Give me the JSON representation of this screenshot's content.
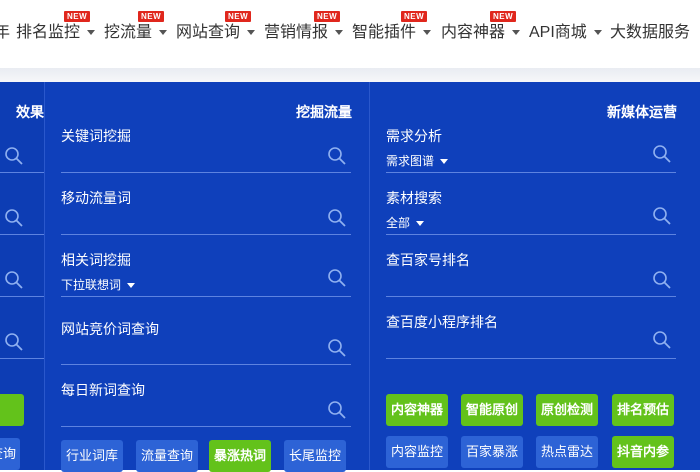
{
  "nav": {
    "items": [
      {
        "label": "年",
        "caret": false,
        "badge": ""
      },
      {
        "label": "排名监控",
        "caret": true,
        "badge": "NEW"
      },
      {
        "label": "挖流量",
        "caret": true,
        "badge": "NEW"
      },
      {
        "label": "网站查询",
        "caret": true,
        "badge": "NEW"
      },
      {
        "label": "营销情报",
        "caret": true,
        "badge": "NEW"
      },
      {
        "label": "智能插件",
        "caret": true,
        "badge": "NEW"
      },
      {
        "label": "内容神器",
        "caret": true,
        "badge": "NEW"
      },
      {
        "label": "API商城",
        "caret": true,
        "badge": ""
      },
      {
        "label": "大数据服务",
        "caret": false,
        "badge": ""
      }
    ]
  },
  "left_col": {
    "title": "效果",
    "button_label": "查询"
  },
  "mid_col": {
    "title": "挖掘流量",
    "tools": [
      {
        "label": "关键词挖掘",
        "sub": ""
      },
      {
        "label": "移动流量词",
        "sub": ""
      },
      {
        "label": "相关词挖掘",
        "sub": "下拉联想词"
      },
      {
        "label": "网站竞价词查询",
        "sub": ""
      },
      {
        "label": "每日新词查询",
        "sub": ""
      }
    ],
    "buttons": [
      {
        "label": "行业词库",
        "style": "blue"
      },
      {
        "label": "流量查询",
        "style": "blue"
      },
      {
        "label": "暴涨热词",
        "style": "green"
      },
      {
        "label": "长尾监控",
        "style": "blue"
      }
    ]
  },
  "right_col": {
    "title": "新媒体运营",
    "tools": [
      {
        "label": "需求分析",
        "sub": "需求图谱"
      },
      {
        "label": "素材搜索",
        "sub": "全部"
      },
      {
        "label": "查百家号排名",
        "sub": ""
      },
      {
        "label": "查百度小程序排名",
        "sub": ""
      }
    ],
    "buttons_row1": [
      {
        "label": "内容神器",
        "style": "green"
      },
      {
        "label": "智能原创",
        "style": "green"
      },
      {
        "label": "原创检测",
        "style": "green"
      },
      {
        "label": "排名预估",
        "style": "green"
      }
    ],
    "buttons_row2": [
      {
        "label": "内容监控",
        "style": "blue"
      },
      {
        "label": "百家暴涨",
        "style": "blue"
      },
      {
        "label": "热点雷达",
        "style": "blue"
      },
      {
        "label": "抖音内参",
        "style": "green"
      }
    ]
  },
  "colors": {
    "panel_bg": "#0f40bb",
    "green_button": "#63c21b",
    "blue_button": "#2d63d6",
    "badge_red": "#e0271d"
  }
}
